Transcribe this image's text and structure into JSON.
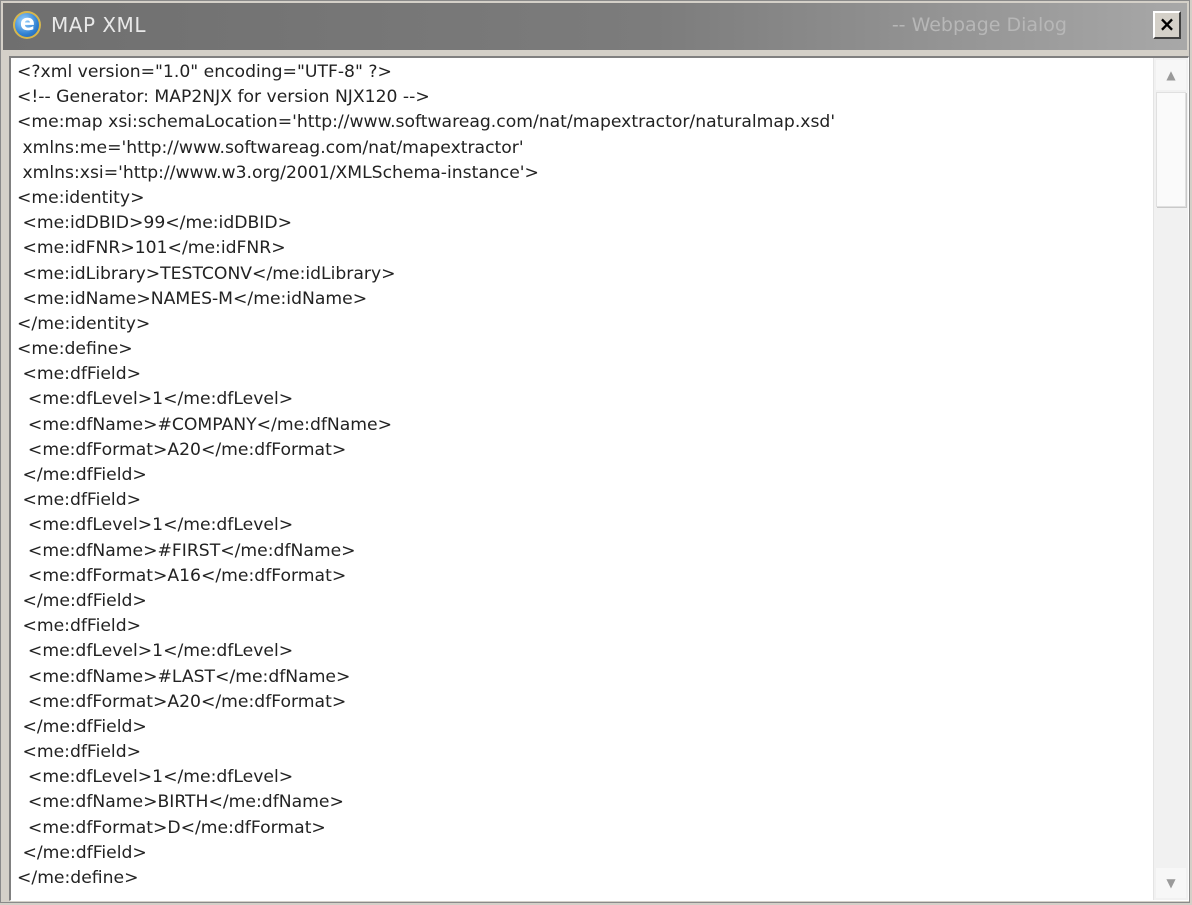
{
  "window": {
    "title": "MAP XML",
    "suffix": "-- Webpage Dialog",
    "close_label": "×"
  },
  "icons": {
    "app_icon": "internet-explorer-icon",
    "close_icon": "close-icon",
    "scroll_up_icon": "triangle-up-icon",
    "scroll_down_icon": "triangle-down-icon"
  },
  "colors": {
    "titlebar": "#7c7c7c",
    "content_background": "#ffffff",
    "text": "#222222"
  },
  "scrollbar": {
    "up_arrow": "▲",
    "down_arrow": "▼"
  },
  "xml_lines": [
    "<?xml version=\"1.0\" encoding=\"UTF-8\" ?>",
    "<!-- Generator: MAP2NJX for version NJX120 -->",
    "<me:map xsi:schemaLocation='http://www.softwareag.com/nat/mapextractor/naturalmap.xsd'",
    " xmlns:me='http://www.softwareag.com/nat/mapextractor'",
    " xmlns:xsi='http://www.w3.org/2001/XMLSchema-instance'>",
    "<me:identity>",
    " <me:idDBID>99</me:idDBID>",
    " <me:idFNR>101</me:idFNR>",
    " <me:idLibrary>TESTCONV</me:idLibrary>",
    " <me:idName>NAMES-M</me:idName>",
    "</me:identity>",
    "<me:define>",
    " <me:dfField>",
    "  <me:dfLevel>1</me:dfLevel>",
    "  <me:dfName>#COMPANY</me:dfName>",
    "  <me:dfFormat>A20</me:dfFormat>",
    " </me:dfField>",
    " <me:dfField>",
    "  <me:dfLevel>1</me:dfLevel>",
    "  <me:dfName>#FIRST</me:dfName>",
    "  <me:dfFormat>A16</me:dfFormat>",
    " </me:dfField>",
    " <me:dfField>",
    "  <me:dfLevel>1</me:dfLevel>",
    "  <me:dfName>#LAST</me:dfName>",
    "  <me:dfFormat>A20</me:dfFormat>",
    " </me:dfField>",
    " <me:dfField>",
    "  <me:dfLevel>1</me:dfLevel>",
    "  <me:dfName>BIRTH</me:dfName>",
    "  <me:dfFormat>D</me:dfFormat>",
    " </me:dfField>",
    "</me:define>"
  ]
}
